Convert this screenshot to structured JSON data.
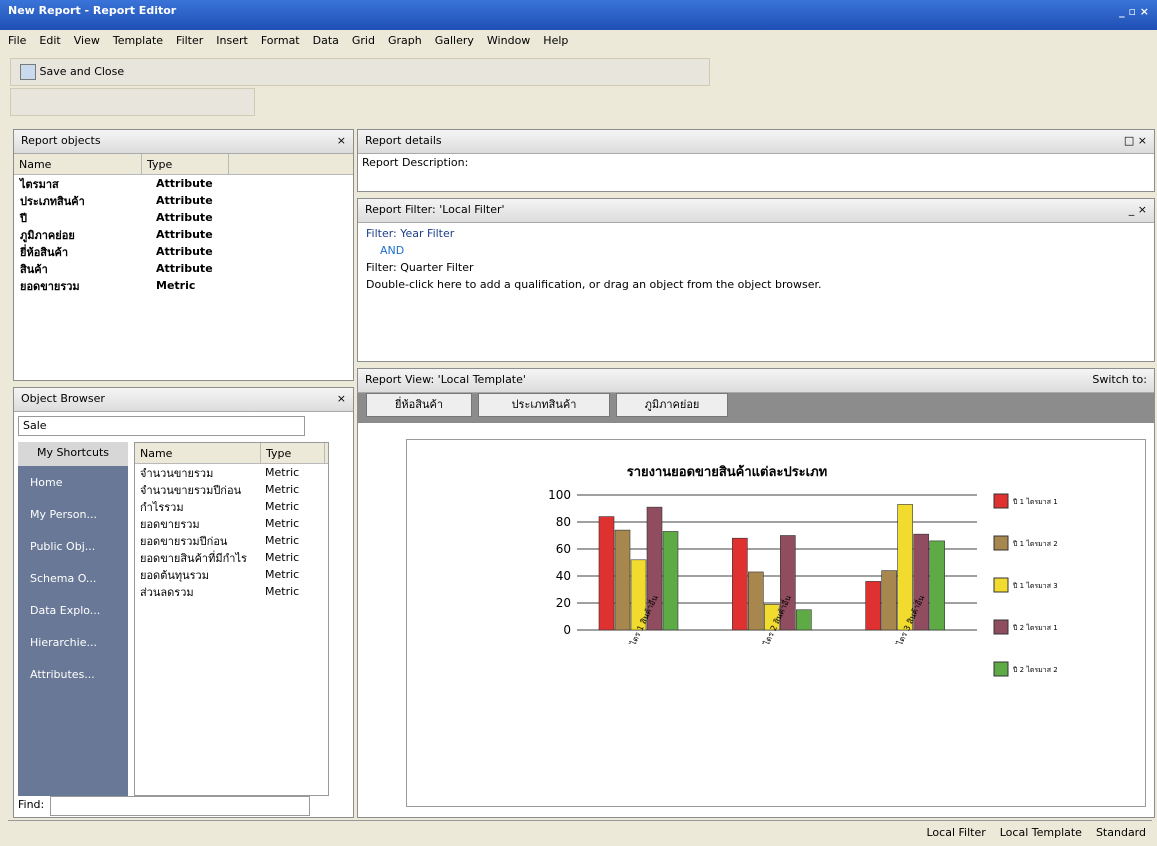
{
  "window": {
    "title": "New Report - Report Editor",
    "controls": [
      "_",
      "▫",
      "x"
    ]
  },
  "menu": [
    "File",
    "Edit",
    "View",
    "Template",
    "Filter",
    "Insert",
    "Format",
    "Data",
    "Grid",
    "Graph",
    "Gallery",
    "Window",
    "Help"
  ],
  "toolbar": {
    "save_close": "Save and Close"
  },
  "report_objects": {
    "title": "Report objects",
    "col_name": "Name",
    "col_type": "Type",
    "items": [
      {
        "name": "ไตรมาส",
        "type": "Attribute"
      },
      {
        "name": "ประเภทสินค้า",
        "type": "Attribute"
      },
      {
        "name": "ปี",
        "type": "Attribute"
      },
      {
        "name": "ภูมิภาคย่อย",
        "type": "Attribute"
      },
      {
        "name": "ยี่ห้อสินค้า",
        "type": "Attribute"
      },
      {
        "name": "สินค้า",
        "type": "Attribute"
      },
      {
        "name": "ยอดขายรวม",
        "type": "Metric"
      }
    ]
  },
  "object_browser": {
    "title": "Object Browser",
    "folder": "Sale",
    "shortcuts_header": "My Shortcuts",
    "shortcuts": [
      "Home",
      "My Person...",
      "Public Obj...",
      "Schema O...",
      "Data Explo...",
      "Hierarchie...",
      "Attributes..."
    ],
    "col_name": "Name",
    "col_type": "Type",
    "items": [
      {
        "name": "จำนวนขายรวม",
        "type": "Metric"
      },
      {
        "name": "จำนวนขายรวมปีก่อน",
        "type": "Metric"
      },
      {
        "name": "กำไรรวม",
        "type": "Metric"
      },
      {
        "name": "ยอดขายรวม",
        "type": "Metric"
      },
      {
        "name": "ยอดขายรวมปีก่อน",
        "type": "Metric"
      },
      {
        "name": "ยอดขายสินค้าที่มีกำไร",
        "type": "Metric"
      },
      {
        "name": "ยอดต้นทุนรวม",
        "type": "Metric"
      },
      {
        "name": "ส่วนลดรวม",
        "type": "Metric"
      }
    ],
    "find_label": "Find:"
  },
  "report_details": {
    "title": "Report details",
    "description": "Report Description:"
  },
  "report_filter": {
    "title": "Report Filter: 'Local Filter'",
    "line1": "Filter: Year Filter",
    "and": "AND",
    "line2": "Filter: Quarter Filter",
    "hint": "Double-click here to add a qualification, or drag an object from the object browser."
  },
  "report_view": {
    "title": "Report View: 'Local Template'",
    "switch_to": "Switch to:",
    "tabs": [
      "ยี่ห้อสินค้า",
      "ประเภทสินค้า",
      "ภูมิภาคย่อย"
    ]
  },
  "chart_data": {
    "type": "bar",
    "title": "รายงานยอดขายสินค้าแต่ละประเภท",
    "categories": [
      "ไตร 1 สินค้าอื่น",
      "ไตร 2 สินค้าอื่น",
      "ไตร 3 สินค้าอื่น"
    ],
    "ylim": [
      0,
      100
    ],
    "yticks": [
      0,
      20,
      40,
      60,
      80,
      100
    ],
    "series": [
      {
        "name": "ปี 1 ไตรมาส 1",
        "color": "#e03131",
        "values": [
          84,
          68,
          36
        ]
      },
      {
        "name": "ปี 1 ไตรมาส 2",
        "color": "#a8874f",
        "values": [
          74,
          43,
          44
        ]
      },
      {
        "name": "ปี 1 ไตรมาส 3",
        "color": "#f0db2e",
        "values": [
          52,
          19,
          93
        ]
      },
      {
        "name": "ปี 2 ไตรมาส 1",
        "color": "#8f4d5f",
        "values": [
          91,
          70,
          71
        ]
      },
      {
        "name": "ปี 2 ไตรมาส 2",
        "color": "#5eaa45",
        "values": [
          73,
          15,
          66
        ]
      }
    ]
  },
  "status": {
    "filter": "Local Filter",
    "template": "Local Template",
    "mode": "Standard"
  }
}
